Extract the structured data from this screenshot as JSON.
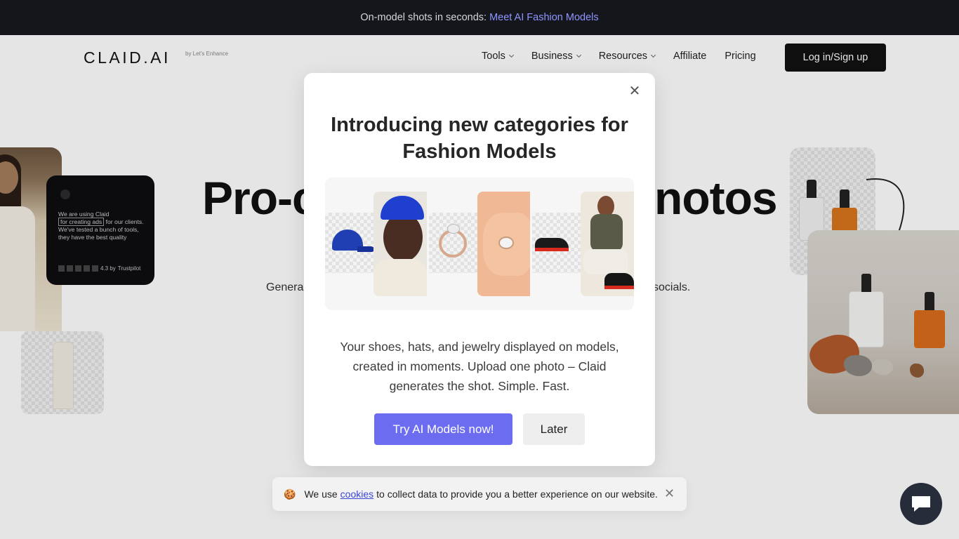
{
  "announcement": {
    "lead": "On-model shots in seconds:",
    "link": "Meet AI Fashion Models"
  },
  "header": {
    "logo": "CLAID.AI",
    "logo_sub": "by Let's Enhance",
    "nav": [
      {
        "label": "Tools",
        "has_dropdown": true
      },
      {
        "label": "Business",
        "has_dropdown": true
      },
      {
        "label": "Resources",
        "has_dropdown": true
      },
      {
        "label": "Affiliate",
        "has_dropdown": false
      },
      {
        "label": "Pricing",
        "has_dropdown": false
      }
    ],
    "login_label": "Log in/Sign up"
  },
  "hero": {
    "title_left": "Pro-c",
    "title_right": "notos",
    "subtitle_left": "Genera",
    "subtitle_right": "socials."
  },
  "review_card": {
    "text_1": "We are using Claid",
    "text_highlight": "for creating ads",
    "text_2": "for our clients. We've tested a bunch of tools, they have the best quality",
    "rating": "4.3 by",
    "platform": "Trustpilot"
  },
  "modal": {
    "title": "Introducing new categories for Fashion Models",
    "body": "Your shoes, hats, and jewelry displayed on models, created in moments. Upload one photo – Claid generates the shot. Simple. Fast.",
    "primary_button": "Try AI Models now!",
    "secondary_button": "Later",
    "gallery": [
      "hat",
      "ring",
      "sneakers"
    ]
  },
  "cookie_banner": {
    "emoji": "🍪",
    "text_before": "We use",
    "link": "cookies",
    "text_after": "to collect data to provide you a better experience on our website."
  },
  "colors": {
    "accent": "#6b6cf0",
    "announcement_bg": "#14161b",
    "announcement_link": "#8f96ff",
    "dark_button": "#111111",
    "chat_bubble": "#272c3a"
  }
}
